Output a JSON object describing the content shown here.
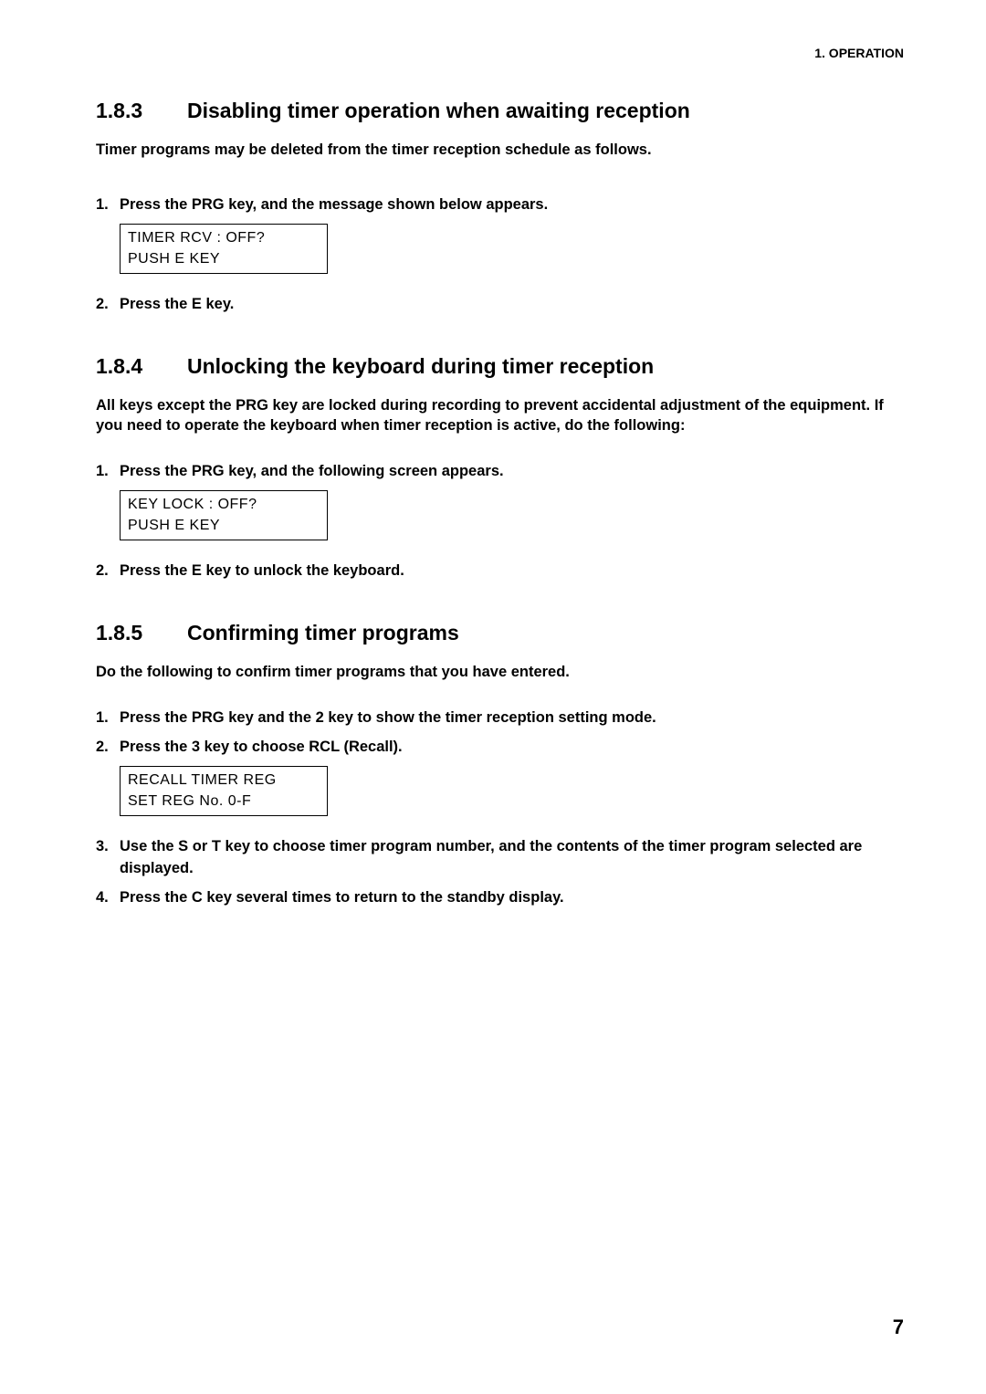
{
  "header_right": "1. OPERATION",
  "page_number": "7",
  "s183": {
    "num": "1.8.3",
    "title": "Disabling timer operation when awaiting reception",
    "intro": "Timer programs may be deleted from the timer reception schedule as follows.",
    "step1_n": "1.",
    "step1_t": "Press the PRG key, and the message shown below appears.",
    "box_l1": "TIMER   RCV  : OFF?",
    "box_l2": "PUSH  E  KEY",
    "step2_n": "2.",
    "step2_t": "Press the E key."
  },
  "s184": {
    "num": "1.8.4",
    "title": "Unlocking the keyboard during timer reception",
    "intro": "All keys except the PRG key are locked during recording to prevent accidental adjustment of the equipment. If you need to operate the keyboard when timer reception is active, do the following:",
    "step1_n": "1.",
    "step1_t": "Press the PRG key, and the following screen appears.",
    "box_l1": "KEY LOCK : OFF?",
    "box_l2": "PUSH   E   KEY",
    "step2_n": "2.",
    "step2_t": "Press the E key to unlock the keyboard."
  },
  "s185": {
    "num": "1.8.5",
    "title": "Confirming timer programs",
    "intro": "Do the following to confirm timer programs that you have entered.",
    "step1_n": "1.",
    "step1_t": "Press the PRG key and the 2 key to show the timer reception setting mode.",
    "step2_n": "2.",
    "step2_t": "Press the 3 key to choose RCL (Recall).",
    "box_l1": "RECALL TIMER  REG",
    "box_l2": "SET  REG   No.  0-F",
    "step3_n": "3.",
    "step3_t": "Use the  S or  T key to choose timer program number, and the contents of the timer program selected are displayed.",
    "step4_n": "4.",
    "step4_t": "Press the C key several times to return to the standby display."
  }
}
